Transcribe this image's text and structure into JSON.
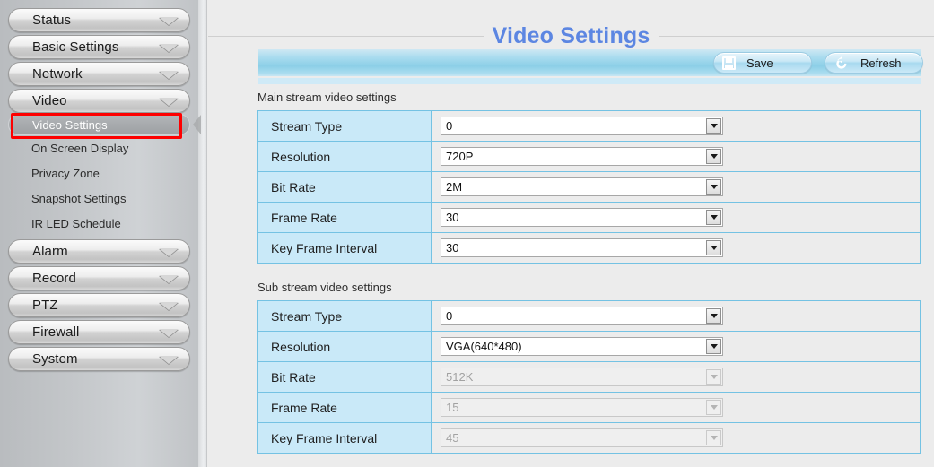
{
  "sidebar": {
    "top_groups": [
      {
        "label": "Status",
        "icon": "chevron-down-icon"
      },
      {
        "label": "Basic Settings",
        "icon": "chevron-down-icon"
      },
      {
        "label": "Network",
        "icon": "chevron-down-icon"
      },
      {
        "label": "Video",
        "icon": "chevron-down-icon"
      }
    ],
    "sub_items": [
      {
        "label": "Video Settings",
        "active": true
      },
      {
        "label": "On Screen Display",
        "active": false
      },
      {
        "label": "Privacy Zone",
        "active": false
      },
      {
        "label": "Snapshot Settings",
        "active": false
      },
      {
        "label": "IR LED Schedule",
        "active": false
      }
    ],
    "bottom_groups": [
      {
        "label": "Alarm",
        "icon": "chevron-down-icon"
      },
      {
        "label": "Record",
        "icon": "chevron-down-icon"
      },
      {
        "label": "PTZ",
        "icon": "chevron-down-icon"
      },
      {
        "label": "Firewall",
        "icon": "chevron-down-icon"
      },
      {
        "label": "System",
        "icon": "chevron-down-icon"
      }
    ],
    "collapse_icon": "chevron-left-icon",
    "highlight_color": "#fe0000"
  },
  "header": {
    "title": "Video Settings",
    "title_color": "#5c86e2"
  },
  "toolbar": {
    "save_label": "Save",
    "save_icon": "floppy-disk-icon",
    "refresh_label": "Refresh",
    "refresh_icon": "refresh-arrow-icon"
  },
  "main_stream": {
    "section_label": "Main stream video settings",
    "rows": [
      {
        "label": "Stream Type",
        "value": "0",
        "disabled": false
      },
      {
        "label": "Resolution",
        "value": "720P",
        "disabled": false
      },
      {
        "label": "Bit Rate",
        "value": "2M",
        "disabled": false
      },
      {
        "label": "Frame Rate",
        "value": "30",
        "disabled": false
      },
      {
        "label": "Key Frame Interval",
        "value": "30",
        "disabled": false
      }
    ]
  },
  "sub_stream": {
    "section_label": "Sub stream video settings",
    "rows": [
      {
        "label": "Stream Type",
        "value": "0",
        "disabled": false
      },
      {
        "label": "Resolution",
        "value": "VGA(640*480)",
        "disabled": false
      },
      {
        "label": "Bit Rate",
        "value": "512K",
        "disabled": true
      },
      {
        "label": "Frame Rate",
        "value": "15",
        "disabled": true
      },
      {
        "label": "Key Frame Interval",
        "value": "45",
        "disabled": true
      }
    ]
  }
}
